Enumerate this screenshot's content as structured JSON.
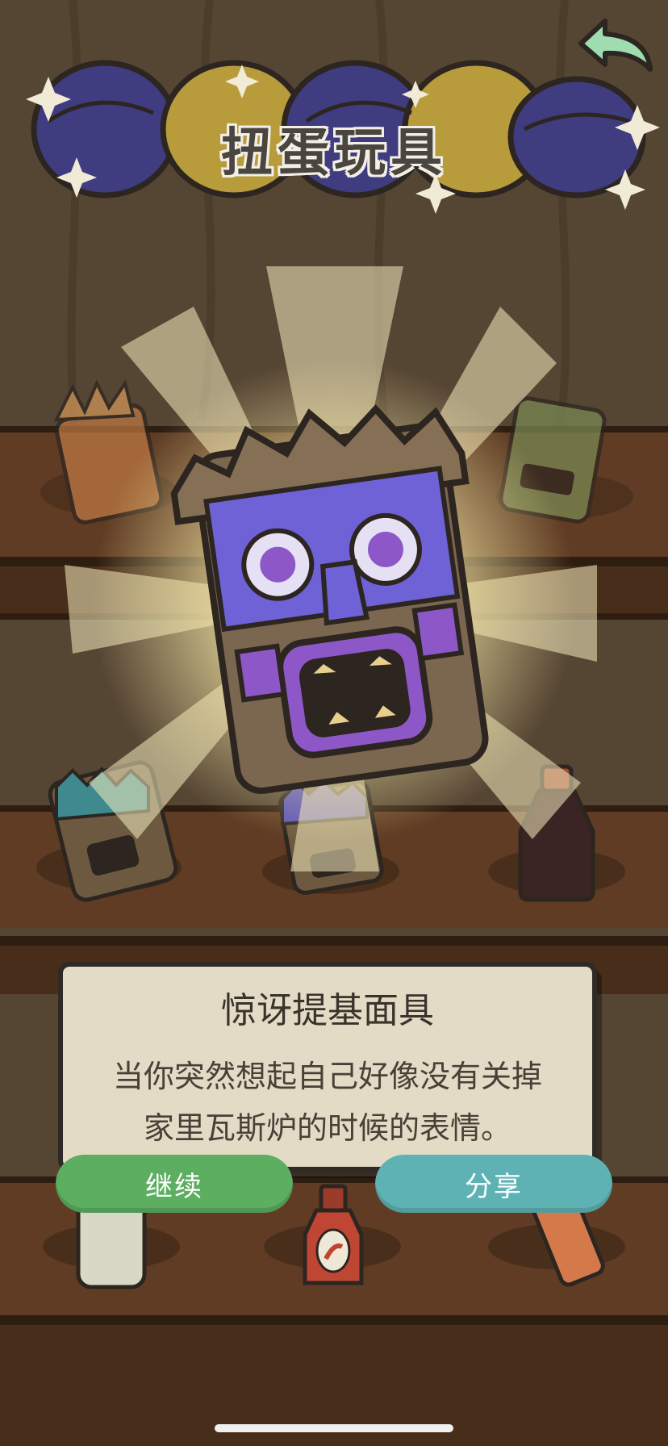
{
  "header": {
    "title": "扭蛋玩具"
  },
  "item_card": {
    "name": "惊讶提基面具",
    "description": "当你突然想起自己好像没有关掉家里瓦斯炉的时候的表情。"
  },
  "actions": {
    "continue_label": "继续",
    "share_label": "分享"
  },
  "colors": {
    "continue_button": "#5cae61",
    "share_button": "#5fb2b4",
    "back_arrow": "#9fdcb0",
    "card_background": "#e3dbc5",
    "mask_purple": "#6e62d6",
    "capsule_blue": "#3f3c80",
    "capsule_yellow": "#b89b3a"
  },
  "icons": {
    "back": "back-arrow-icon",
    "sparkle": "sparkle-icon"
  }
}
